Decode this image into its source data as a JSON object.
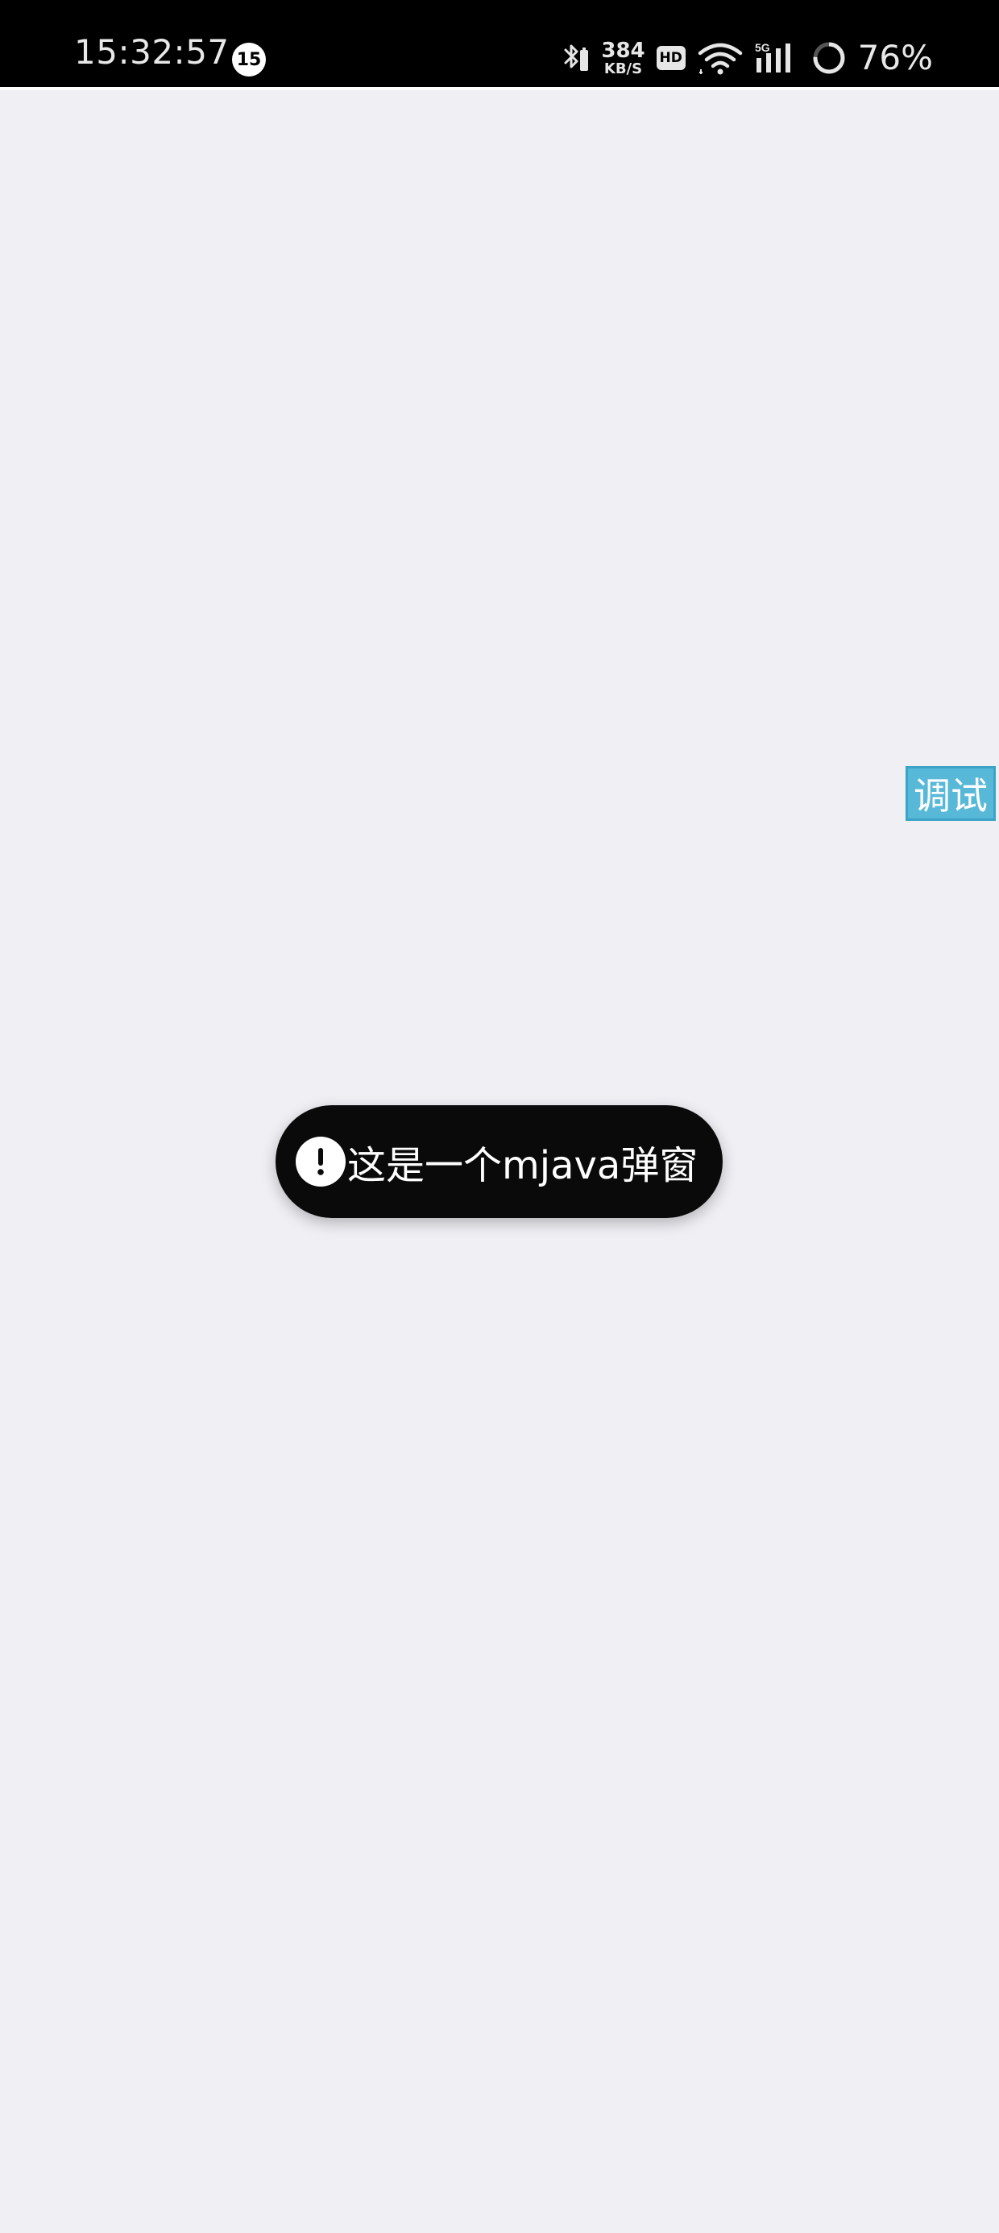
{
  "status_bar": {
    "time": "15:32:57",
    "notification_count": "15",
    "net_speed_value": "384",
    "net_speed_unit": "KB/S",
    "hd_label": "HD",
    "network_type": "5G",
    "battery_percent": "76%",
    "icons": [
      "bluetooth-icon",
      "hd-icon",
      "wifi-icon",
      "signal-icon",
      "battery-ring-icon"
    ]
  },
  "debug_button": {
    "label": "调试"
  },
  "toast": {
    "message": "这是一个mjava弹窗",
    "icon": "exclamation-icon"
  },
  "colors": {
    "background": "#efeff4",
    "status_bar": "#000000",
    "debug_button": "#58b8d8",
    "toast_background": "#0a0a0a"
  }
}
